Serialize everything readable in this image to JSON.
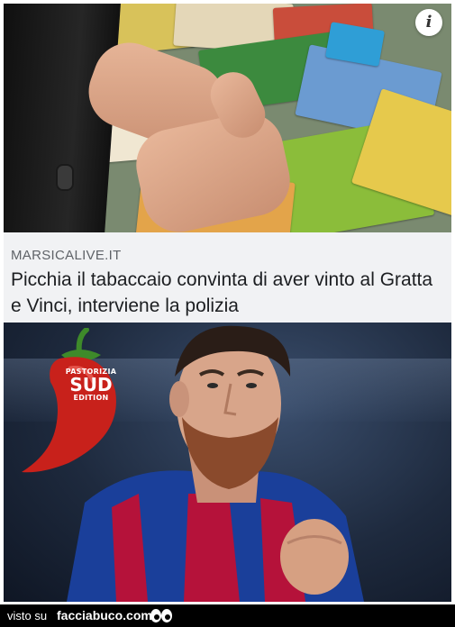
{
  "article": {
    "info_icon": "i",
    "source": "MARSICALIVE.IT",
    "title": "Picchia il tabaccaio convinta di aver vinto al Gratta e Vinci, interviene la polizia"
  },
  "overlay_logo": {
    "line1": "PASTORIZIA",
    "line2": "SUD",
    "line3": "EDITION"
  },
  "footer": {
    "prefix": "visto su",
    "site": "facciabuco.com"
  },
  "colors": {
    "headline_bg": "#f1f2f4",
    "source_text": "#5f6368",
    "footer_bg": "#000000",
    "chili_red": "#c8211b",
    "jersey_blue": "#1a3f9a",
    "jersey_red": "#b5123a"
  }
}
